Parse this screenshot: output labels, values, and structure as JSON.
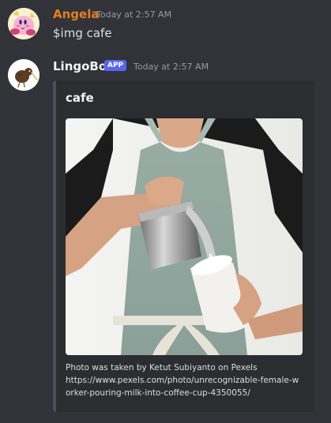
{
  "messages": [
    {
      "username": "Angela",
      "timestamp": "Today at 2:57 AM",
      "text": "$img cafe",
      "avatar": "kirby-avatar",
      "name_color": "#e67e22"
    },
    {
      "username": "LingoBot",
      "badge": "APP",
      "timestamp": "Today at 2:57 AM",
      "avatar": "kiwi-bird-avatar",
      "embed": {
        "title": "cafe",
        "image": "barista-pouring-milk-photo",
        "footer_line1": "Photo was taken by Ketut Subiyanto on Pexels",
        "footer_line2": "https://www.pexels.com/photo/unrecognizable-female-worker-pouring-milk-into-coffee-cup-4350055/"
      }
    }
  ],
  "colors": {
    "background": "#313338",
    "embed_background": "#2b2d31",
    "embed_border": "#4e5058",
    "badge": "#5865f2",
    "timestamp": "#949ba4"
  }
}
